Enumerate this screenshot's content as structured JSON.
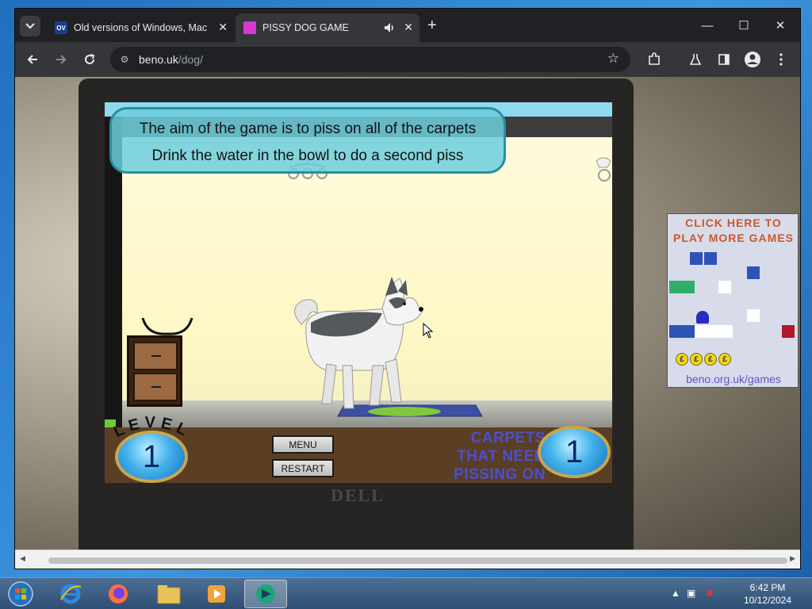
{
  "browser": {
    "tabs": [
      {
        "title": "Old versions of Windows, Mac",
        "favicon": "ov-favicon",
        "active": false
      },
      {
        "title": "PISSY DOG GAME",
        "favicon": "pissy-dog-favicon",
        "active": true
      }
    ],
    "address": {
      "domain": "beno.uk",
      "path": "/dog/"
    }
  },
  "game": {
    "instructions": [
      "The aim of the game is to piss on all of the carpets",
      "Drink the water in the bowl to do a second piss"
    ],
    "level_label": "LEVEL",
    "level": "1",
    "menu_label": "MENU",
    "restart_label": "RESTART",
    "carpets_label": [
      "CARPETS",
      "THAT NEED",
      "PISSING ON"
    ],
    "carpets_count": "1"
  },
  "promo": {
    "title_line1": "CLICK HERE TO",
    "title_line2": "PLAY MORE GAMES",
    "link": "beno.org.uk/games",
    "coin_symbol": "£"
  },
  "monitor_brand": "DELL",
  "taskbar": {
    "time": "6:42 PM",
    "date": "10/12/2024",
    "pinned": [
      "start-orb-icon",
      "internet-explorer-icon",
      "firefox-icon",
      "file-explorer-icon",
      "media-player-icon",
      "chrome-like-app-icon"
    ]
  },
  "colors": {
    "accent": "#2a8ea3",
    "carpets_text": "#4b4fd3",
    "promo_title": "#c9582b",
    "promo_link": "#6b4ecb"
  }
}
